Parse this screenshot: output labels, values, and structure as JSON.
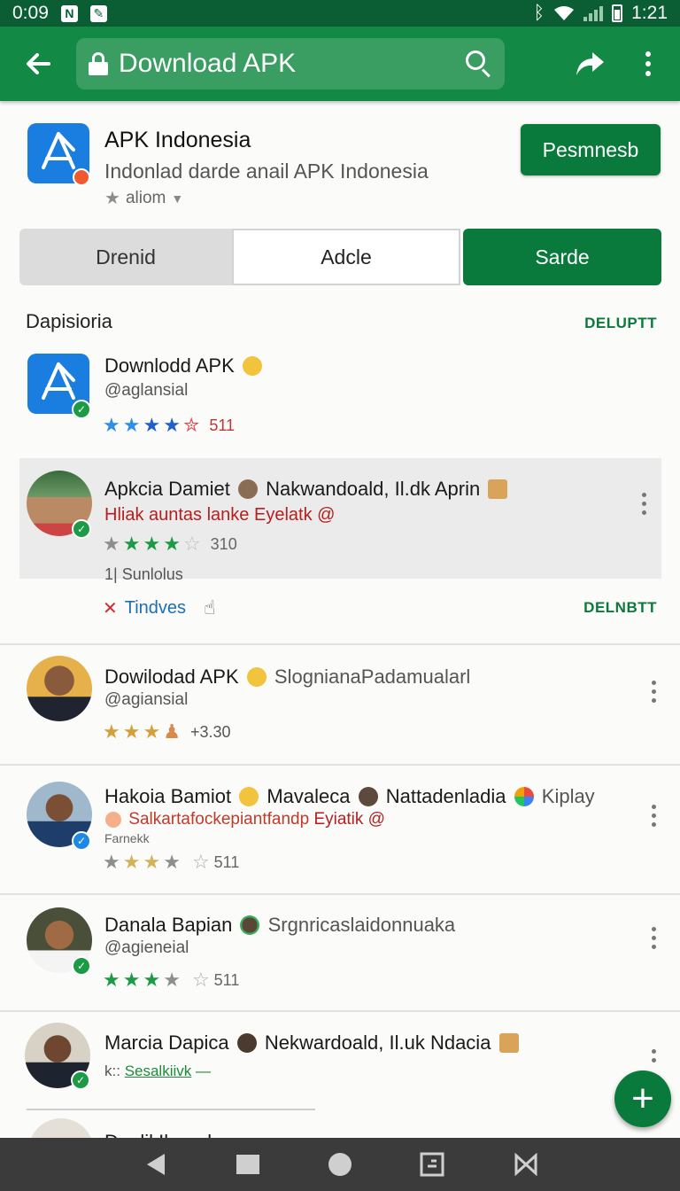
{
  "status_bar": {
    "time_left": "0:09",
    "time_right": "1:21"
  },
  "toolbar": {
    "query": "Download APK"
  },
  "header": {
    "title": "APK Indonesia",
    "subtitle": "Indonlad darde anail  APK Indonesia",
    "meta": "aliom",
    "primary_button": "Pesmnesb"
  },
  "segments": [
    {
      "label": "Drenid"
    },
    {
      "label": "Adcle"
    },
    {
      "label": "Sarde"
    }
  ],
  "section": {
    "title": "Dapisioria",
    "action": "DELUPTT"
  },
  "items": [
    {
      "title": "Downlodd APK",
      "handle": "@aglansial",
      "rating_count": "511",
      "rating": 4
    },
    {
      "title": "Apkcia Damiet",
      "title_extra": "Nakwandoald, Il.dk Aprin",
      "subtitle_a": "Hliak auntas lanke",
      "subtitle_b": "Eyelatk @",
      "rating_count": "310",
      "rating": 4,
      "meta": "1|  Sunlolus",
      "action_a": "Tindves",
      "action_right": "DELNBTT"
    },
    {
      "title": "Dowilodad APK",
      "title_extra": "SlognianaPadamualarl",
      "handle": "@agiansial",
      "rating_count": "+3.30",
      "rating": 3
    },
    {
      "title": "Hakoia Bamiot",
      "title_extra_1": "Mavaleca",
      "title_extra_2": "Nattadenladia",
      "title_extra_3": "Kiplay",
      "subtitle_a": "Salkartafockepiantfandp",
      "subtitle_b": "Eyiatik @",
      "meta": "Farnekk",
      "rating_count": "511",
      "rating": 3
    },
    {
      "title": "Danala Bapian",
      "title_extra": "Srgnricaslaidonnuaka",
      "handle": "@agieneial",
      "rating_count": "511",
      "rating": 3
    },
    {
      "title": "Marcia Dapica",
      "title_extra": "Nekwardoald, Il.uk Ndacia",
      "meta": "k::",
      "link": "Sesalkiivk"
    },
    {
      "title": "Dnnlil Ilanndn"
    }
  ],
  "colors": {
    "status_bar": "#0b5d33",
    "toolbar": "#128a45",
    "accent": "#0a7a3c",
    "star_green": "#1d9a45",
    "star_gold": "#d4a03a"
  }
}
